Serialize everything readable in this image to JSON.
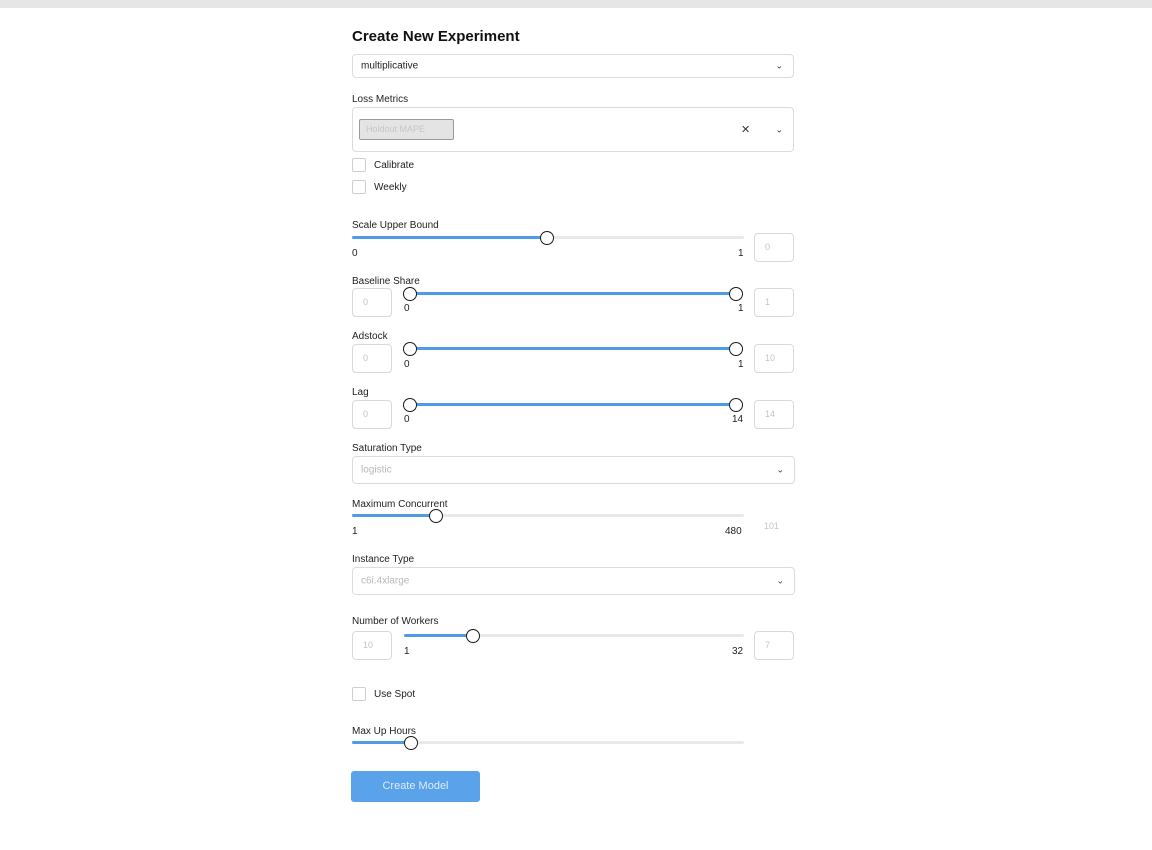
{
  "form": {
    "title": "Create New Experiment",
    "model_type": {
      "value": "multiplicative"
    },
    "loss_metrics": {
      "label": "Loss Metrics",
      "selected_tags": [
        "Holdout MAPE"
      ]
    },
    "calibrate": {
      "label": "Calibrate",
      "checked": false
    },
    "weekly": {
      "label": "Weekly",
      "checked": false
    },
    "scale_upper_bound": {
      "label": "Scale Upper Bound",
      "min": "0",
      "max": "1",
      "input_value": "0",
      "level": 0.5
    },
    "baseline_share": {
      "label": "Baseline Share",
      "min_input": "0",
      "min": "0",
      "max": "1",
      "max_input": "1",
      "range": [
        0,
        1
      ]
    },
    "adstock": {
      "label": "Adstock",
      "min_input": "0",
      "min": "0",
      "max": "1",
      "max_input": "10",
      "range": [
        0,
        1
      ]
    },
    "lag": {
      "label": "Lag",
      "min_input": "0",
      "min": "0",
      "max": "14",
      "max_input": "14",
      "range": [
        0,
        14
      ]
    },
    "saturation_type": {
      "label": "Saturation Type",
      "value": "logistic"
    },
    "maximum_concurrent": {
      "label": "Maximum Concurrent",
      "min": "1",
      "max": "480",
      "value": "101",
      "level": 0.22
    },
    "instance_type": {
      "label": "Instance Type",
      "value": "c6i.4xlarge"
    },
    "number_of_workers": {
      "label": "Number of Workers",
      "left_input": "10",
      "min": "1",
      "max": "32",
      "right_input": "7",
      "level": 0.18
    },
    "use_spot": {
      "label": "Use Spot",
      "checked": false
    },
    "max_up_hours": {
      "label": "Max Up Hours",
      "level": 0.15
    },
    "submit_label": "Create Model"
  },
  "icons": {
    "dropdown": "chevron-down-icon",
    "clear": "close-icon"
  },
  "colors": {
    "accent": "#4f9be6",
    "button": "#5aa2ea",
    "track": "#e9e9e9"
  }
}
